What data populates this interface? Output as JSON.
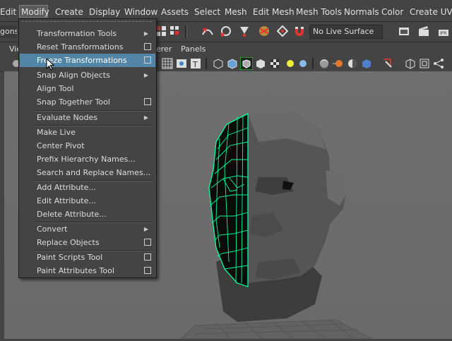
{
  "menubar": [
    "Edit",
    "Modify",
    "Create",
    "Display",
    "Window",
    "Assets",
    "Select",
    "Mesh",
    "Edit Mesh",
    "Mesh Tools",
    "Normals",
    "Color",
    "Create UVs"
  ],
  "shelf": {
    "mode_label": "gons",
    "live_surface": "No Live Surface"
  },
  "panel_menu": [
    "Vie",
    "erer",
    "Panels"
  ],
  "modify_menu": [
    {
      "label": "Transformation Tools",
      "type": "submenu"
    },
    {
      "label": "Reset Transformations",
      "type": "option"
    },
    {
      "label": "Freeze Transformations",
      "type": "option",
      "highlighted": true
    },
    {
      "label": "Snap Align Objects",
      "type": "submenu"
    },
    {
      "label": "Align Tool",
      "type": "plain"
    },
    {
      "label": "Snap Together Tool",
      "type": "option"
    },
    {
      "label": "Evaluate Nodes",
      "type": "submenu"
    },
    {
      "label": "Make Live",
      "type": "plain"
    },
    {
      "label": "Center Pivot",
      "type": "plain"
    },
    {
      "label": "Prefix Hierarchy Names...",
      "type": "plain"
    },
    {
      "label": "Search and Replace Names...",
      "type": "plain"
    },
    {
      "label": "Add Attribute...",
      "type": "plain"
    },
    {
      "label": "Edit Attribute...",
      "type": "plain"
    },
    {
      "label": "Delete Attribute...",
      "type": "plain"
    },
    {
      "label": "Convert",
      "type": "submenu"
    },
    {
      "label": "Replace Objects",
      "type": "option"
    },
    {
      "label": "Paint Scripts Tool",
      "type": "option"
    },
    {
      "label": "Paint Attributes Tool",
      "type": "option"
    }
  ],
  "colors": {
    "highlight": "#5285a6",
    "wire": "#00ff9c",
    "mesh": "#4a4a4a"
  }
}
